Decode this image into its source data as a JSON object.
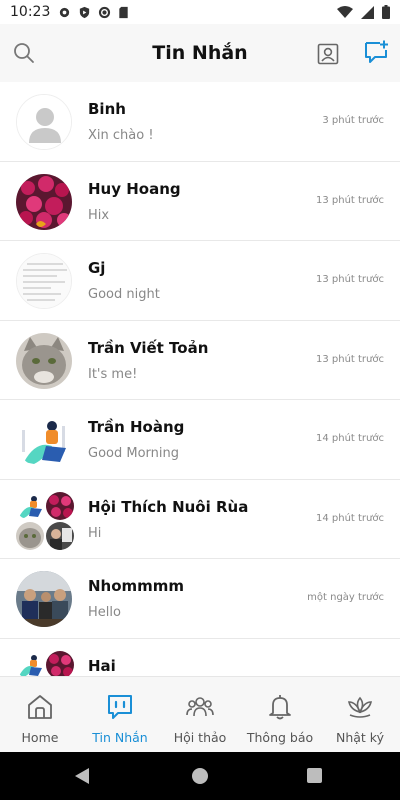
{
  "status_bar": {
    "time": "10:23"
  },
  "header": {
    "title": "Tin Nhắn"
  },
  "colors": {
    "accent": "#1a8fd6",
    "muted_text": "#888888"
  },
  "conversations": [
    {
      "name": "Binh",
      "preview": "Xin chào !",
      "time": "3 phút trước"
    },
    {
      "name": "Huy Hoang",
      "preview": "Hix",
      "time": "13 phút trước"
    },
    {
      "name": "Gj",
      "preview": "Good night",
      "time": "13 phút trước"
    },
    {
      "name": "Trần Viết Toản",
      "preview": "It's me!",
      "time": "13 phút trước"
    },
    {
      "name": "Trần Hoàng",
      "preview": "Good Morning",
      "time": "14 phút trước"
    },
    {
      "name": "Hội Thích Nuôi Rùa",
      "preview": "Hi",
      "time": "14 phút trước"
    },
    {
      "name": "Nhommmm",
      "preview": "Hello",
      "time": "một ngày trước"
    },
    {
      "name": "Hai",
      "preview": "",
      "time": ""
    }
  ],
  "bottom_nav": [
    {
      "label": "Home",
      "icon": "home-icon"
    },
    {
      "label": "Tin Nhắn",
      "icon": "chat-icon",
      "active": true
    },
    {
      "label": "Hội thảo",
      "icon": "group-icon"
    },
    {
      "label": "Thông báo",
      "icon": "bell-icon"
    },
    {
      "label": "Nhật ký",
      "icon": "lotus-icon"
    }
  ]
}
